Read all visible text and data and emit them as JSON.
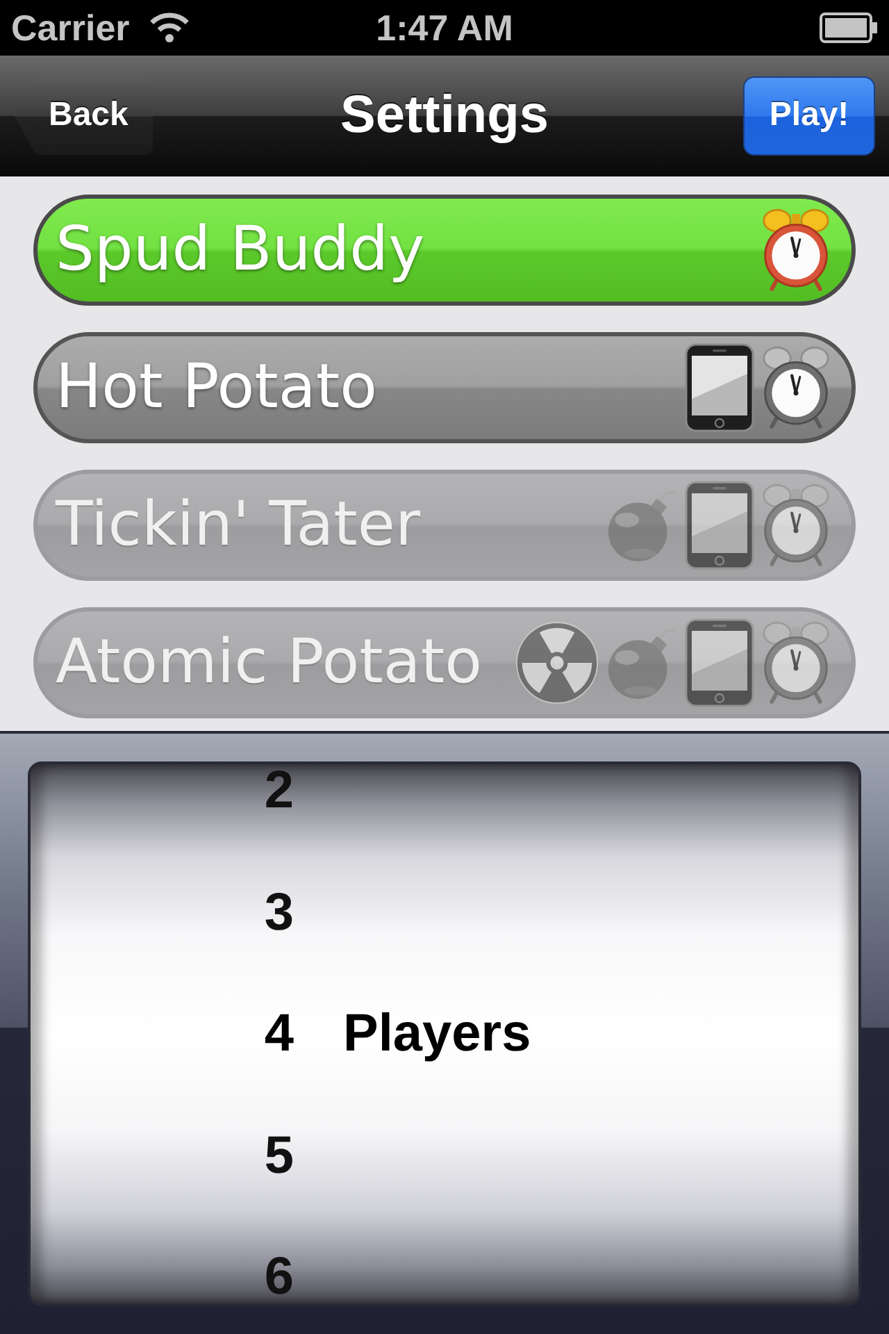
{
  "status_bar": {
    "carrier": "Carrier",
    "time": "1:47 AM"
  },
  "nav_bar": {
    "back": "Back",
    "title": "Settings",
    "action": "Play!"
  },
  "modes": [
    {
      "label": "Spud Buddy",
      "selected": true,
      "disabled": false,
      "icons": [
        {
          "kind": "clock"
        }
      ]
    },
    {
      "label": "Hot Potato",
      "selected": false,
      "disabled": false,
      "icons": [
        {
          "kind": "phone"
        },
        {
          "kind": "clock"
        }
      ]
    },
    {
      "label": "Tickin' Tater",
      "selected": false,
      "disabled": true,
      "icons": [
        {
          "kind": "bomb"
        },
        {
          "kind": "phone"
        },
        {
          "kind": "clock"
        }
      ]
    },
    {
      "label": "Atomic Potato",
      "selected": false,
      "disabled": true,
      "icons": [
        {
          "kind": "radiation"
        },
        {
          "kind": "bomb"
        },
        {
          "kind": "phone"
        },
        {
          "kind": "clock"
        }
      ]
    }
  ],
  "picker": {
    "items": [
      {
        "label": "2",
        "selected": false
      },
      {
        "label": "3",
        "selected": false
      },
      {
        "label": "4",
        "selected": true
      },
      {
        "label": "5",
        "selected": false
      },
      {
        "label": "6",
        "selected": false
      }
    ],
    "unit_label": "Players"
  }
}
